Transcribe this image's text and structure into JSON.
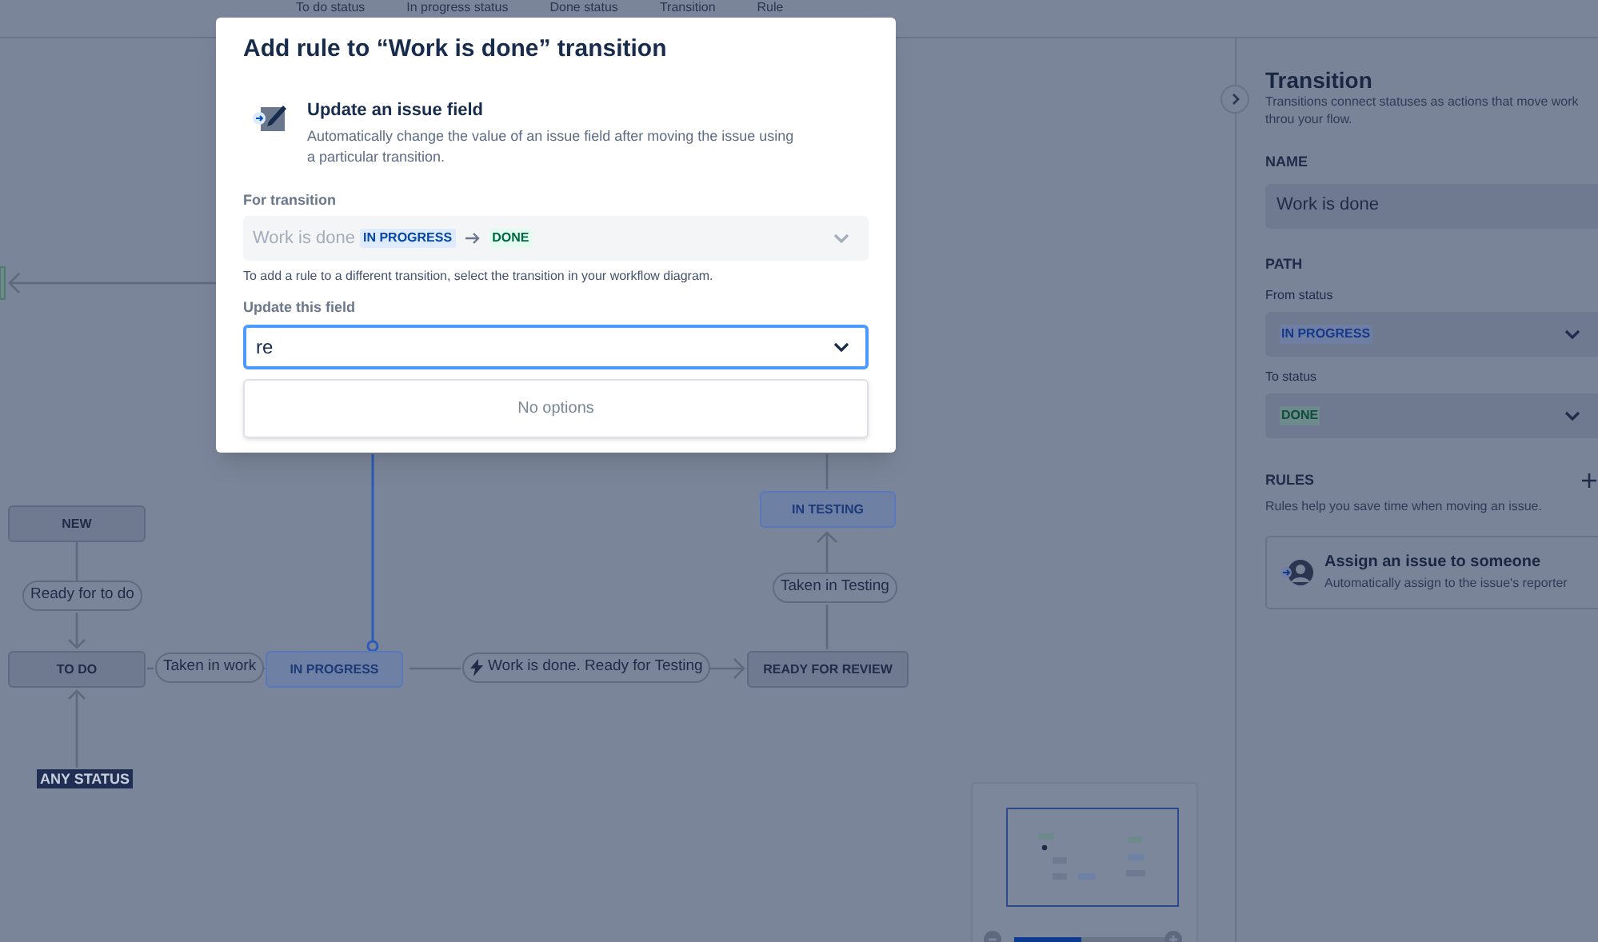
{
  "top_bar": {
    "tabs": [
      {
        "label": "To do status"
      },
      {
        "label": "In progress status"
      },
      {
        "label": "Done status"
      },
      {
        "label": "Transition"
      },
      {
        "label": "Rule"
      }
    ]
  },
  "diagram": {
    "statuses": [
      {
        "label": "IN TESTING",
        "kind": "in_progress"
      },
      {
        "label": "NEW",
        "kind": "todo"
      },
      {
        "label": "TO DO",
        "kind": "todo"
      },
      {
        "label": "IN PROGRESS",
        "kind": "in_progress"
      },
      {
        "label": "READY FOR REVIEW",
        "kind": "todo"
      }
    ],
    "transitions": [
      {
        "label": "Ready for to do",
        "has_rule": false
      },
      {
        "label": "Taken in work",
        "has_rule": false
      },
      {
        "label": "Work is done. Ready for Testing",
        "has_rule": true
      },
      {
        "label": "Taken in Testing",
        "has_rule": false
      }
    ],
    "any_status": "ANY STATUS"
  },
  "minimap": {
    "zoom": {
      "level": 0.45
    }
  },
  "side_panel": {
    "title": "Transition",
    "description": "Transitions connect statuses as actions that move work throu your flow.",
    "name_label": "NAME",
    "name_value": "Work is done",
    "path_label": "PATH",
    "from_label": "From status",
    "from_value": {
      "label": "IN PROGRESS",
      "kind": "in_progress"
    },
    "to_label": "To status",
    "to_value": {
      "label": "DONE",
      "kind": "done"
    },
    "rules_label": "RULES",
    "rules_description": "Rules help you save time when moving an issue.",
    "rules": [
      {
        "title": "Assign an issue to someone",
        "description": "Automatically assign to the issue's reporter"
      }
    ]
  },
  "dialog": {
    "title": "Add rule to “Work is done” transition",
    "rule_type": {
      "title": "Update an issue field",
      "description": "Automatically change the value of an issue field after moving the issue using a particular transition."
    },
    "for_transition": {
      "label": "For transition",
      "name": "Work is done",
      "from": {
        "label": "IN PROGRESS",
        "kind": "in_progress"
      },
      "to": {
        "label": "DONE",
        "kind": "done"
      },
      "disabled": true
    },
    "helper": "To add a rule to a different transition, select the transition in your workflow diagram.",
    "update_field": {
      "label": "Update this field",
      "value": "re",
      "focused": true
    },
    "menu": {
      "message": "No options"
    }
  }
}
